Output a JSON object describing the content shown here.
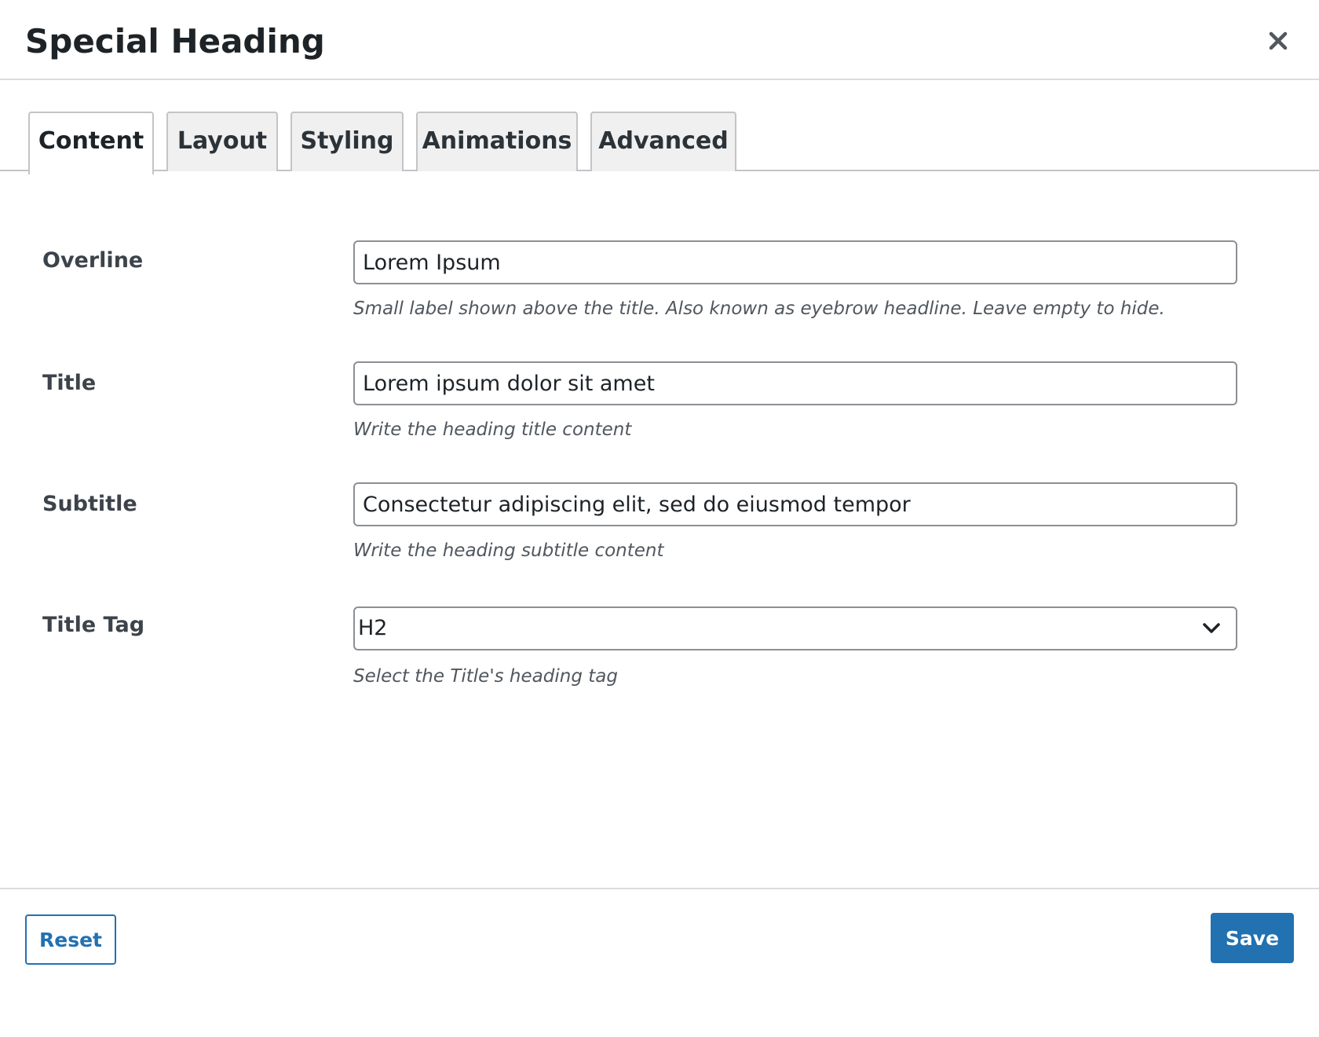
{
  "modal": {
    "title": "Special Heading",
    "close_icon": "close-icon"
  },
  "tabs": [
    {
      "label": "Content",
      "active": true
    },
    {
      "label": "Layout",
      "active": false
    },
    {
      "label": "Styling",
      "active": false
    },
    {
      "label": "Animations",
      "active": false
    },
    {
      "label": "Advanced",
      "active": false
    }
  ],
  "fields": {
    "overline": {
      "label": "Overline",
      "value": "Lorem Ipsum",
      "hint": "Small label shown above the title. Also known as eyebrow headline. Leave empty to hide."
    },
    "title": {
      "label": "Title",
      "value": "Lorem ipsum dolor sit amet",
      "hint": "Write the heading title content"
    },
    "subtitle": {
      "label": "Subtitle",
      "value": "Consectetur adipiscing elit, sed do eiusmod tempor",
      "hint": "Write the heading subtitle content"
    },
    "title_tag": {
      "label": "Title Tag",
      "selected": "H2",
      "hint": "Select the Title's heading tag",
      "chevron_icon": "chevron-down-icon"
    }
  },
  "footer": {
    "reset_label": "Reset",
    "save_label": "Save"
  },
  "colors": {
    "accent": "#2271b1",
    "border": "#8c8f94",
    "tab_bg": "#f0f0f1",
    "text": "#1d2327",
    "hint": "#50575e"
  }
}
